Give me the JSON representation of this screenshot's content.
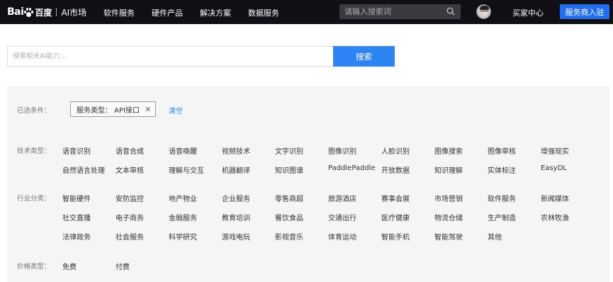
{
  "header": {
    "logo_text": "Bai",
    "logo_du": "百度",
    "logo_market": "AI市场",
    "nav": [
      "软件服务",
      "硬件产品",
      "解决方案",
      "数据服务"
    ],
    "search_placeholder": "请输入搜索词",
    "seller_center": "买家中心",
    "provider_button": "服务商入驻"
  },
  "main_search": {
    "placeholder": "搜索相关AI能力...",
    "button": "搜索"
  },
  "filters": {
    "selected_label": "已选条件：",
    "selected_chip": "服务类型： API接口",
    "clear": "清空",
    "tech_label": "技术类型：",
    "tech_row1": [
      "语音识别",
      "语音合成",
      "语音唤醒",
      "视频技术",
      "文字识别",
      "图像识别",
      "人脸识别",
      "图像搜索",
      "图像审核",
      "增强现实"
    ],
    "tech_row2": [
      "自然语言处理",
      "文本审核",
      "理解与交互",
      "机器翻译",
      "知识图谱",
      "PaddlePaddle",
      "开放数据",
      "知识理解",
      "实体标注",
      "EasyDL"
    ],
    "industry_label": "行业分类：",
    "industry_row1": [
      "智能硬件",
      "安防监控",
      "地产物业",
      "企业服务",
      "零售商超",
      "旅游酒店",
      "赛事会展",
      "市场营销",
      "软件服务",
      "新闻媒体"
    ],
    "industry_row2": [
      "社交直播",
      "电子商务",
      "金融服务",
      "教育培训",
      "餐饮食品",
      "交通出行",
      "医疗健康",
      "物流仓储",
      "生产制造",
      "农林牧渔"
    ],
    "industry_row3": [
      "法律政务",
      "社会服务",
      "科学研究",
      "游戏电玩",
      "影视音乐",
      "体育运动",
      "智能手机",
      "智能驾驶",
      "其他"
    ],
    "price_label": "价格类型：",
    "price": [
      "免费",
      "付费"
    ]
  },
  "colors": {
    "topbar": "#0f0f14",
    "accent": "#2d85f5",
    "panel": "#f5f5f6"
  }
}
